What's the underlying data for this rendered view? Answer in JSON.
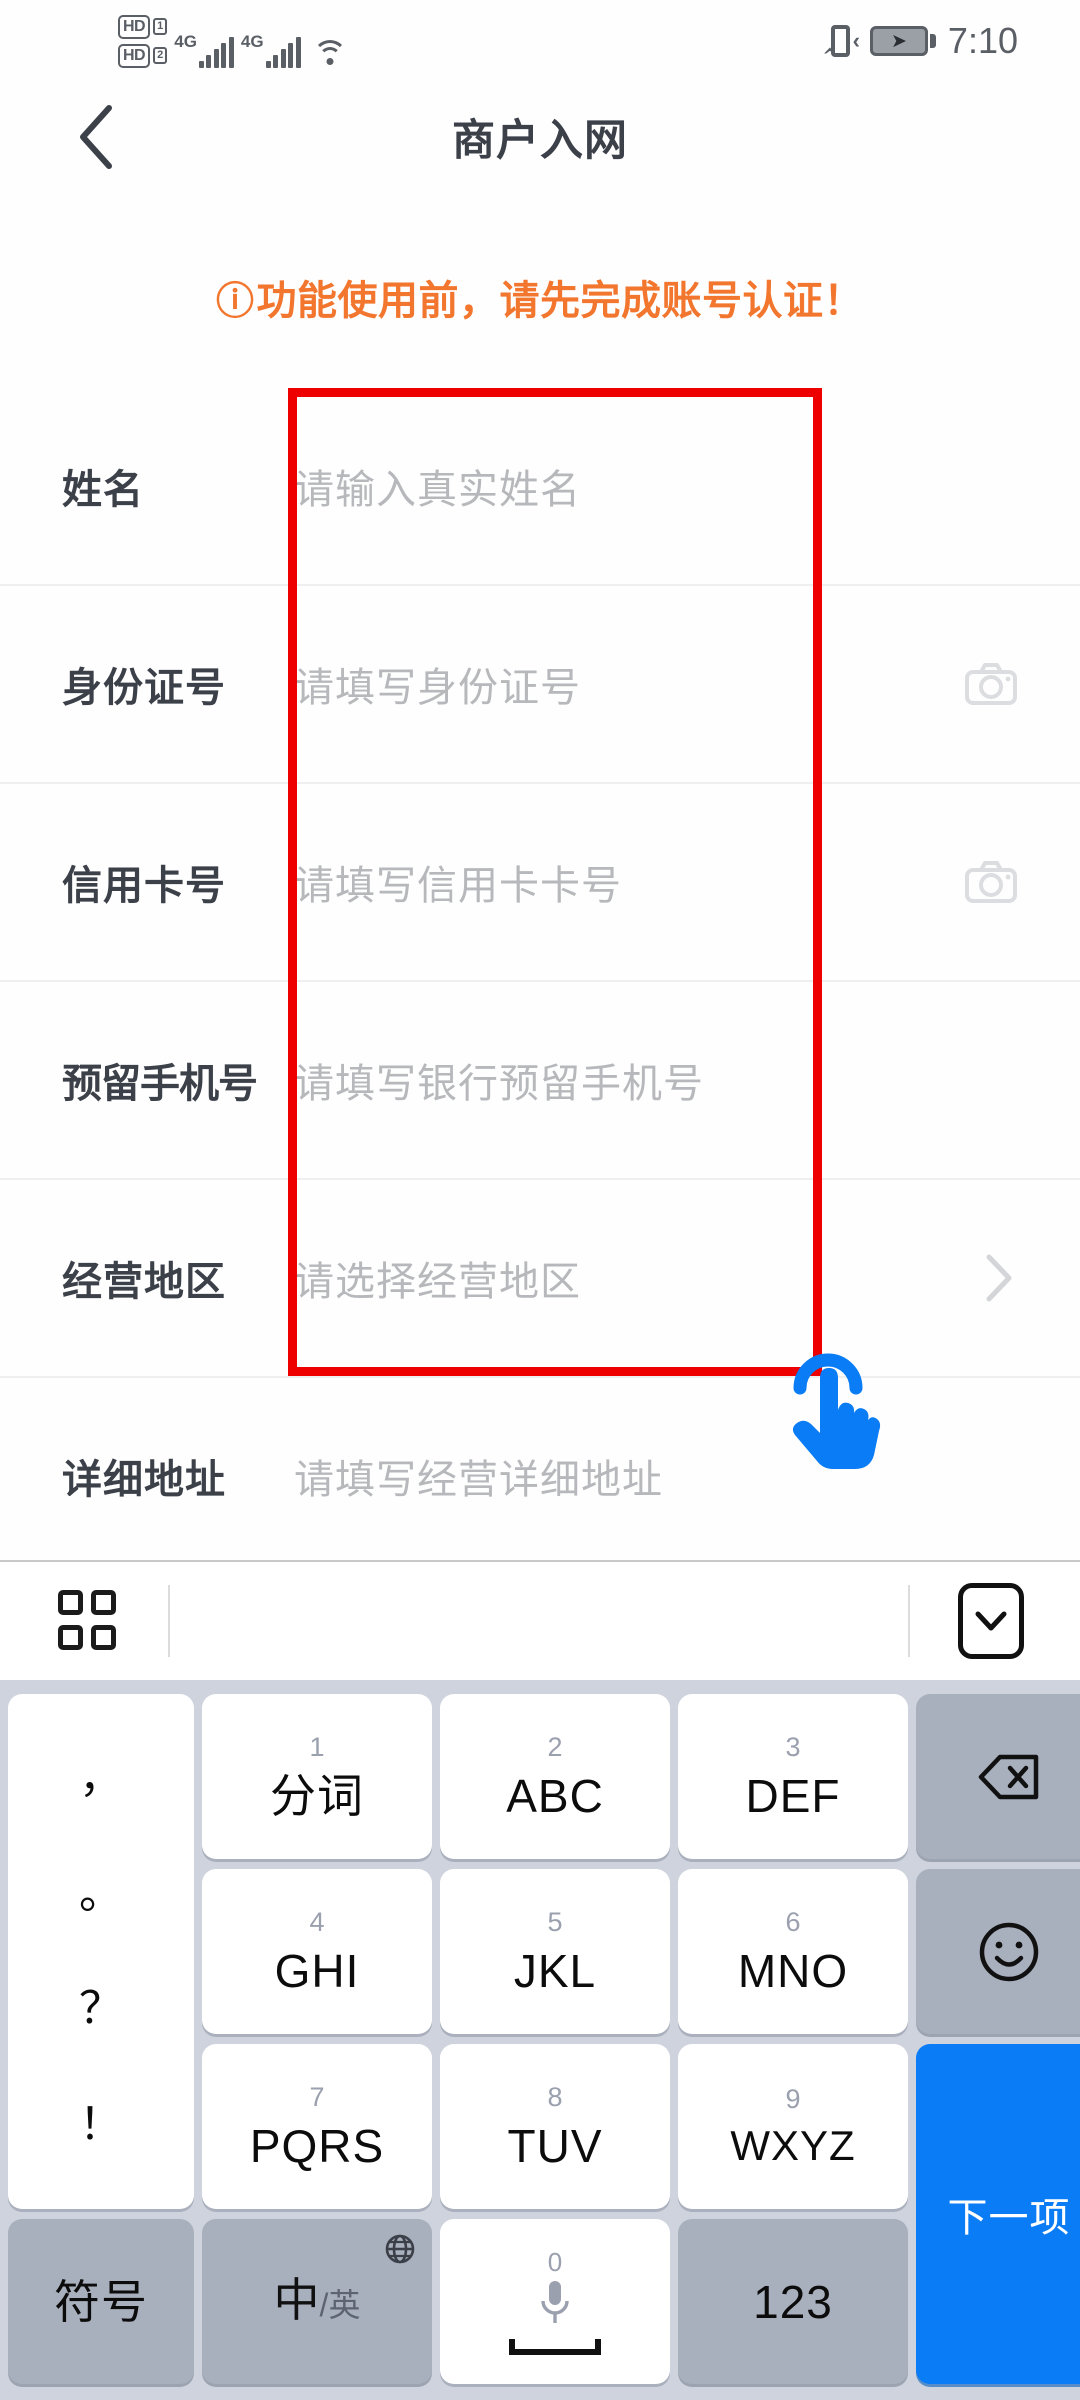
{
  "statusbar": {
    "hd1_label": "HD",
    "hd1_num": "1",
    "hd2_label": "HD",
    "hd2_num": "2",
    "net1": "4G",
    "net2": "4G",
    "wifi_icon": "wifi-icon",
    "vibrate_icon": "vibrate-icon",
    "battery_icon": "battery-charging-icon",
    "time": "7:10"
  },
  "nav": {
    "back_icon": "chevron-left-icon",
    "title": "商户入网"
  },
  "warning": {
    "icon": "⚠",
    "text": "功能使用前，请先完成账号认证！",
    "color": "#f2762e"
  },
  "form": {
    "rows": [
      {
        "label": "姓名",
        "placeholder": "请输入真实姓名",
        "trailing": "none"
      },
      {
        "label": "身份证号",
        "placeholder": "请填写身份证号",
        "trailing": "camera"
      },
      {
        "label": "信用卡号",
        "placeholder": "请填写信用卡卡号",
        "trailing": "camera"
      },
      {
        "label": "预留手机号",
        "placeholder": "请填写银行预留手机号",
        "trailing": "none"
      },
      {
        "label": "经营地区",
        "placeholder": "请选择经营地区",
        "trailing": "chevron"
      },
      {
        "label": "详细地址",
        "placeholder": "请填写经营详细地址",
        "trailing": "none"
      }
    ]
  },
  "annotation": {
    "box_color": "#ee0000",
    "tap_color": "#0a7cf5",
    "tap_icon": "tap-hand-icon"
  },
  "keyboard_toolbar": {
    "grid_icon": "apps-grid-icon",
    "collapse_icon": "collapse-keyboard-icon"
  },
  "keyboard": {
    "punct_key": {
      "chars": [
        "，",
        "。",
        "？",
        "！"
      ]
    },
    "keys": [
      {
        "num": "1",
        "main": "分词"
      },
      {
        "num": "2",
        "main": "ABC"
      },
      {
        "num": "3",
        "main": "DEF"
      },
      {
        "num": "4",
        "main": "GHI"
      },
      {
        "num": "5",
        "main": "JKL"
      },
      {
        "num": "6",
        "main": "MNO"
      },
      {
        "num": "7",
        "main": "PQRS"
      },
      {
        "num": "8",
        "main": "TUV"
      },
      {
        "num": "9",
        "main": "WXYZ"
      }
    ],
    "backspace_icon": "backspace-icon",
    "emoji_icon": "emoji-smiley-icon",
    "next_label": "下一项",
    "symbol_label": "符号",
    "lang_main": "中",
    "lang_sub": "/英",
    "globe_icon": "globe-icon",
    "space_zero": "0",
    "mic_icon": "microphone-icon",
    "numeric_label": "123"
  }
}
